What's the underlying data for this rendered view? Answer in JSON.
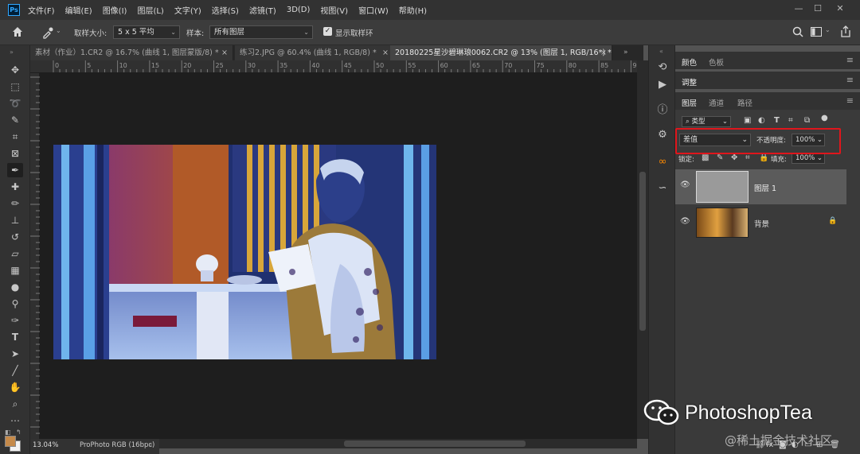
{
  "app": {
    "logo": "Ps",
    "menu": [
      "文件(F)",
      "编辑(E)",
      "图像(I)",
      "图层(L)",
      "文字(Y)",
      "选择(S)",
      "滤镜(T)",
      "3D(D)",
      "视图(V)",
      "窗口(W)",
      "帮助(H)"
    ],
    "window_controls": [
      "—",
      "☐",
      "✕"
    ]
  },
  "options_bar": {
    "sample_size_label": "取样大小:",
    "sample_size_value": "5 x 5 平均",
    "sample_label": "样本:",
    "sample_value": "所有图层",
    "show_ring_label": "显示取样环",
    "show_ring_checked": true
  },
  "tabs": [
    {
      "label": "素材（作业）1.CR2 @ 16.7% (曲线 1, 图层蒙版/8) *",
      "active": false
    },
    {
      "label": "练习2.JPG @ 60.4% (曲线 1, RGB/8) *",
      "active": false
    },
    {
      "label": "20180225星沙碧琳琅0062.CR2 @ 13% (图层 1, RGB/16*) *",
      "active": true
    }
  ],
  "ruler_ticks": [
    "0",
    "5",
    "10",
    "15",
    "20",
    "25",
    "30",
    "35",
    "40",
    "45",
    "50",
    "55",
    "60",
    "65",
    "70",
    "75",
    "80",
    "85",
    "90"
  ],
  "status": {
    "zoom": "13.04%",
    "profile": "ProPhoto RGB (16bpc)"
  },
  "panels": {
    "color_tabs": [
      "颜色",
      "色板"
    ],
    "adjust_tab": "调整",
    "layer_tabs": [
      "图层",
      "通道",
      "路径"
    ],
    "filter_kind": "类型",
    "blend_mode": "差值",
    "opacity_label": "不透明度:",
    "opacity_value": "100%",
    "lock_label": "锁定:",
    "fill_label": "填充:",
    "fill_value": "100%",
    "layers": [
      {
        "name": "图层 1",
        "selected": true,
        "locked": false
      },
      {
        "name": "背景",
        "selected": false,
        "locked": true
      }
    ]
  },
  "watermark": {
    "brand": "PhotoshopTea",
    "site": "@稀土掘金技术社区"
  }
}
